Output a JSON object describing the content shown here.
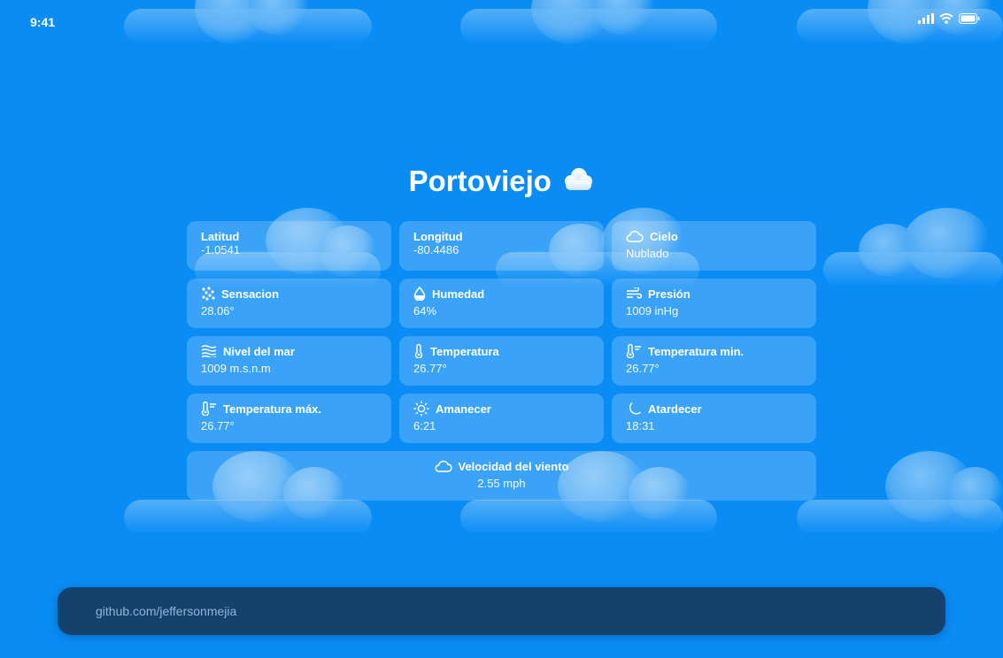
{
  "status_bar": {
    "time": "9:41",
    "icons": [
      "signal-icon",
      "wifi-icon",
      "battery-icon"
    ]
  },
  "city": {
    "name": "Portoviejo",
    "condition_icon": "cloud-icon"
  },
  "cards": [
    {
      "id": "latitud",
      "label": "Latitud",
      "value": "-1.0541",
      "icon": ""
    },
    {
      "id": "longitud",
      "label": "Longitud",
      "value": "-80.4486",
      "icon": ""
    },
    {
      "id": "cielo",
      "label": "Cielo",
      "value": "Nublado",
      "icon": "cloud-outline-icon"
    },
    {
      "id": "sensacion",
      "label": "Sensacion",
      "value": "28.06°",
      "icon": "dots-icon"
    },
    {
      "id": "humedad",
      "label": "Humedad",
      "value": "64%",
      "icon": "droplet-icon"
    },
    {
      "id": "presion",
      "label": "Presión",
      "value": "1009 inHg",
      "icon": "wind-icon"
    },
    {
      "id": "nivel",
      "label": "Nivel del mar",
      "value": "1009 m.s.n.m",
      "icon": "waves-icon"
    },
    {
      "id": "temp",
      "label": "Temperatura",
      "value": "26.77°",
      "icon": "thermometer-icon"
    },
    {
      "id": "tempmin",
      "label": "Temperatura min.",
      "value": "26.77°",
      "icon": "thermometer-low-icon"
    },
    {
      "id": "tempmax",
      "label": "Temperatura máx.",
      "value": "26.77°",
      "icon": "thermometer-high-icon"
    },
    {
      "id": "amanecer",
      "label": "Amanecer",
      "value": "6:21",
      "icon": "sun-icon"
    },
    {
      "id": "atardecer",
      "label": "Atardecer",
      "value": "18:31",
      "icon": "moon-icon"
    },
    {
      "id": "viento",
      "label": "Velocidad del viento",
      "value": "2.55 mph",
      "icon": "cloud-outline-icon"
    }
  ],
  "footer": {
    "text": "github.com/jeffersonmejia"
  },
  "colors": {
    "background": "#0a8cf5",
    "card": "rgba(255,255,255,0.20)",
    "footer": "#14426c",
    "footer_text": "#8fb6d8"
  }
}
